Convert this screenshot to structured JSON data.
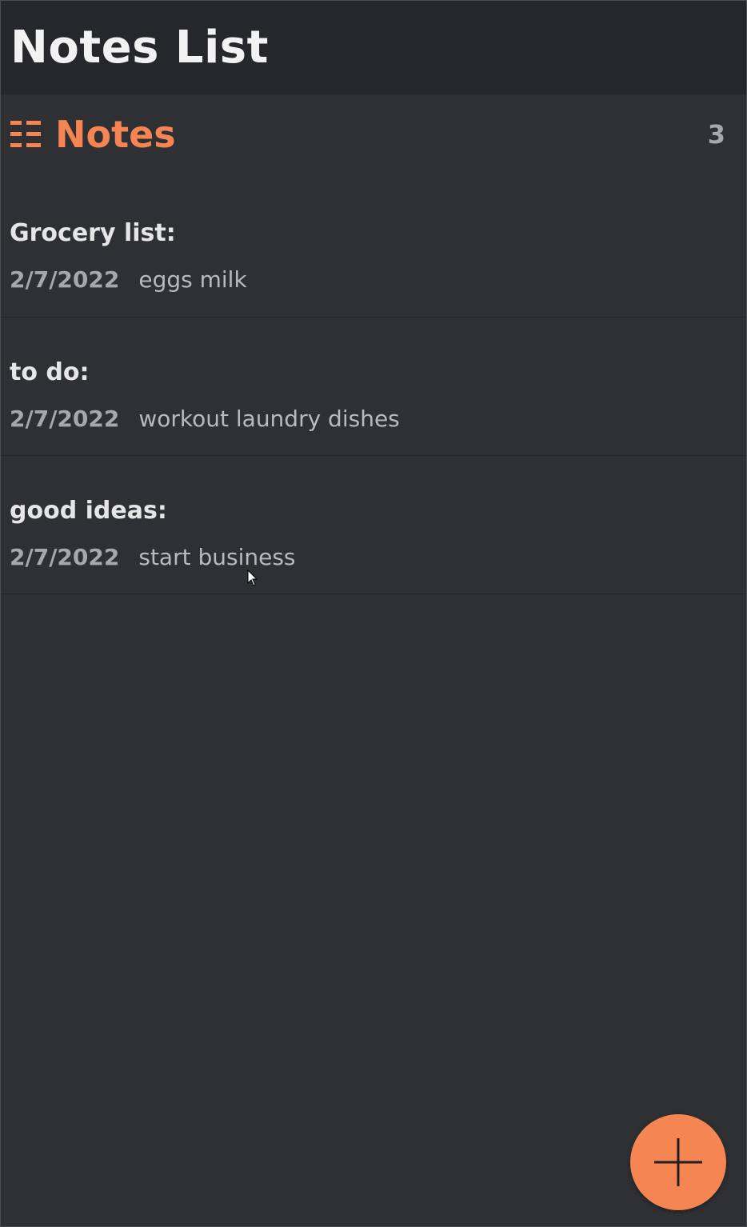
{
  "app": {
    "title": "Notes List"
  },
  "section": {
    "icon": "list-icon",
    "title": "Notes",
    "count": "3"
  },
  "notes": [
    {
      "title": "Grocery list:",
      "date": "2/7/2022",
      "body": "eggs milk"
    },
    {
      "title": "to do:",
      "date": "2/7/2022",
      "body": "workout laundry dishes"
    },
    {
      "title": "good ideas:",
      "date": "2/7/2022",
      "body": "start business"
    }
  ],
  "fab": {
    "icon": "plus-icon"
  },
  "colors": {
    "accent": "#f58552",
    "header_bg": "#25272a",
    "page_bg": "#2e3033",
    "title_text": "#f2f2f2",
    "muted_text": "#a6a8ab"
  }
}
